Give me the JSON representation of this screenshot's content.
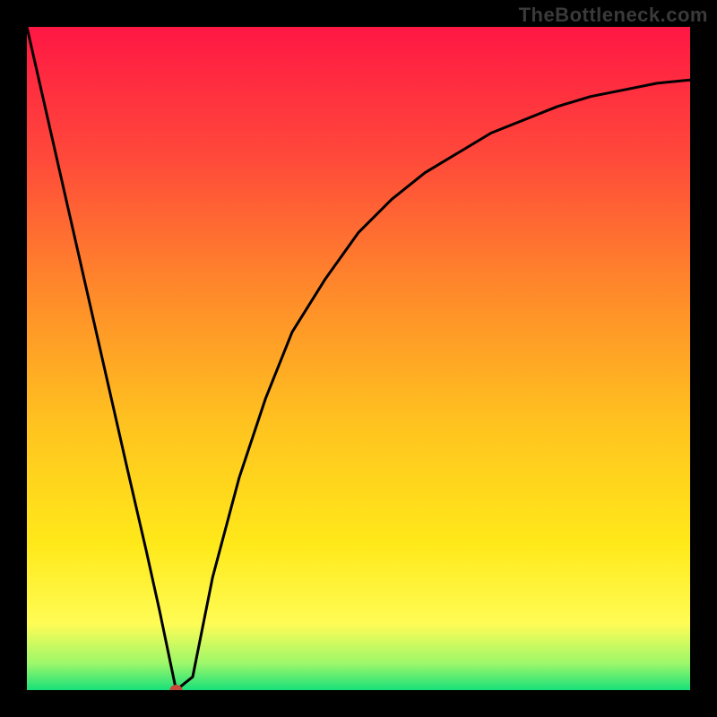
{
  "watermark": "TheBottleneck.com",
  "chart_data": {
    "type": "line",
    "title": "",
    "xlabel": "",
    "ylabel": "",
    "xlim": [
      0,
      100
    ],
    "ylim": [
      0,
      100
    ],
    "grid": false,
    "legend": false,
    "series": [
      {
        "name": "curve",
        "x": [
          0,
          5,
          10,
          15,
          18,
          20,
          22.5,
          25,
          28,
          32,
          36,
          40,
          45,
          50,
          55,
          60,
          65,
          70,
          75,
          80,
          85,
          90,
          95,
          100
        ],
        "y": [
          100,
          78,
          56,
          34,
          21,
          12,
          0,
          2,
          17,
          32,
          44,
          54,
          62,
          69,
          74,
          78,
          81,
          84,
          86,
          88,
          89.5,
          90.5,
          91.5,
          92
        ]
      }
    ],
    "marker": {
      "x": 22.5,
      "y": 0,
      "color": "#c94a3a"
    },
    "background": {
      "type": "vertical-gradient",
      "stops": [
        {
          "offset": 0.0,
          "color": "#ff1744"
        },
        {
          "offset": 0.2,
          "color": "#ff4a3a"
        },
        {
          "offset": 0.4,
          "color": "#ff8a2a"
        },
        {
          "offset": 0.6,
          "color": "#ffc31f"
        },
        {
          "offset": 0.78,
          "color": "#ffe91a"
        },
        {
          "offset": 0.9,
          "color": "#fffc55"
        },
        {
          "offset": 0.96,
          "color": "#9cf76a"
        },
        {
          "offset": 1.0,
          "color": "#18e07a"
        }
      ]
    }
  }
}
